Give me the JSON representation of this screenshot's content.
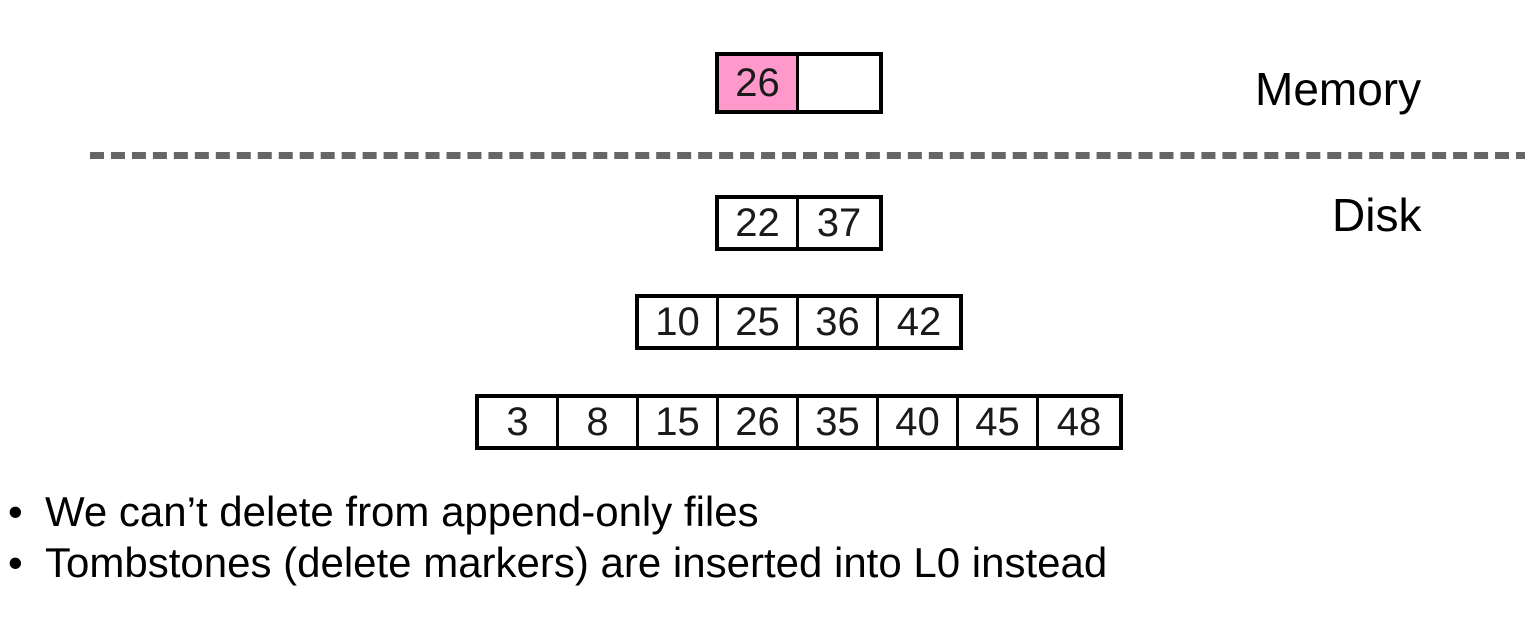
{
  "slide": {
    "title_absent": true,
    "background_color": "#ffffff",
    "text_color": "#000000"
  },
  "diagram": {
    "type": "lsm-tree",
    "highlight_color": "#FF99CC",
    "border_color": "#000000",
    "divider": {
      "name": "memory-disk-divider",
      "style": "dashed",
      "color": "#666666"
    },
    "labels": {
      "memory": "Memory",
      "disk": "Disk"
    },
    "rows": [
      {
        "name": "memtable",
        "region": "memory",
        "cells": [
          {
            "value": "26",
            "highlight": true
          },
          {
            "value": "",
            "highlight": false
          }
        ]
      },
      {
        "name": "level-0",
        "region": "disk",
        "cells": [
          {
            "value": "22",
            "highlight": false
          },
          {
            "value": "37",
            "highlight": false
          }
        ]
      },
      {
        "name": "level-1",
        "region": "disk",
        "cells": [
          {
            "value": "10",
            "highlight": false
          },
          {
            "value": "25",
            "highlight": false
          },
          {
            "value": "36",
            "highlight": false
          },
          {
            "value": "42",
            "highlight": false
          }
        ]
      },
      {
        "name": "level-2",
        "region": "disk",
        "cells": [
          {
            "value": "3",
            "highlight": false
          },
          {
            "value": "8",
            "highlight": false
          },
          {
            "value": "15",
            "highlight": false
          },
          {
            "value": "26",
            "highlight": false
          },
          {
            "value": "35",
            "highlight": false
          },
          {
            "value": "40",
            "highlight": false
          },
          {
            "value": "45",
            "highlight": false
          },
          {
            "value": "48",
            "highlight": false
          }
        ]
      }
    ]
  },
  "bullets": {
    "marker": "•",
    "items": [
      {
        "text": "We can’t delete from append-only files"
      },
      {
        "text": "Tombstones (delete markers) are inserted into L0 instead"
      }
    ]
  }
}
